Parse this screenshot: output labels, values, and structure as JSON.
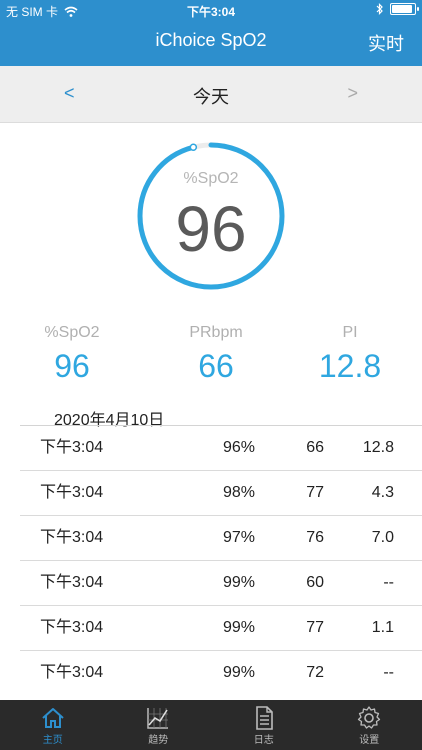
{
  "status_bar": {
    "carrier": "无 SIM 卡",
    "time": "下午3:04"
  },
  "header": {
    "title": "iChoice SpO2",
    "realtime_button": "实时"
  },
  "date_nav": {
    "prev": "<",
    "label": "今天",
    "next": ">"
  },
  "gauge": {
    "label": "%SpO2",
    "value": "96",
    "level": 0.96
  },
  "metrics": [
    {
      "label": "%SpO2",
      "value": "96"
    },
    {
      "label": "PRbpm",
      "value": "66"
    },
    {
      "label": "PI",
      "value": "12.8"
    }
  ],
  "records": {
    "date": "2020年4月10日",
    "rows": [
      {
        "time": "下午3:04",
        "spo2": "96%",
        "pr": "66",
        "pi": "12.8"
      },
      {
        "time": "下午3:04",
        "spo2": "98%",
        "pr": "77",
        "pi": "4.3"
      },
      {
        "time": "下午3:04",
        "spo2": "97%",
        "pr": "76",
        "pi": "7.0"
      },
      {
        "time": "下午3:04",
        "spo2": "99%",
        "pr": "60",
        "pi": "--"
      },
      {
        "time": "下午3:04",
        "spo2": "99%",
        "pr": "77",
        "pi": "1.1"
      },
      {
        "time": "下午3:04",
        "spo2": "99%",
        "pr": "72",
        "pi": "--"
      }
    ]
  },
  "tabs": [
    {
      "label": "主页",
      "icon": "home-icon",
      "active": true
    },
    {
      "label": "趋势",
      "icon": "trend-icon",
      "active": false
    },
    {
      "label": "日志",
      "icon": "log-icon",
      "active": false
    },
    {
      "label": "设置",
      "icon": "settings-icon",
      "active": false
    }
  ],
  "colors": {
    "header": "#2d8fcd",
    "accent": "#2fa7e0",
    "tabbar": "#2a2a2a"
  }
}
